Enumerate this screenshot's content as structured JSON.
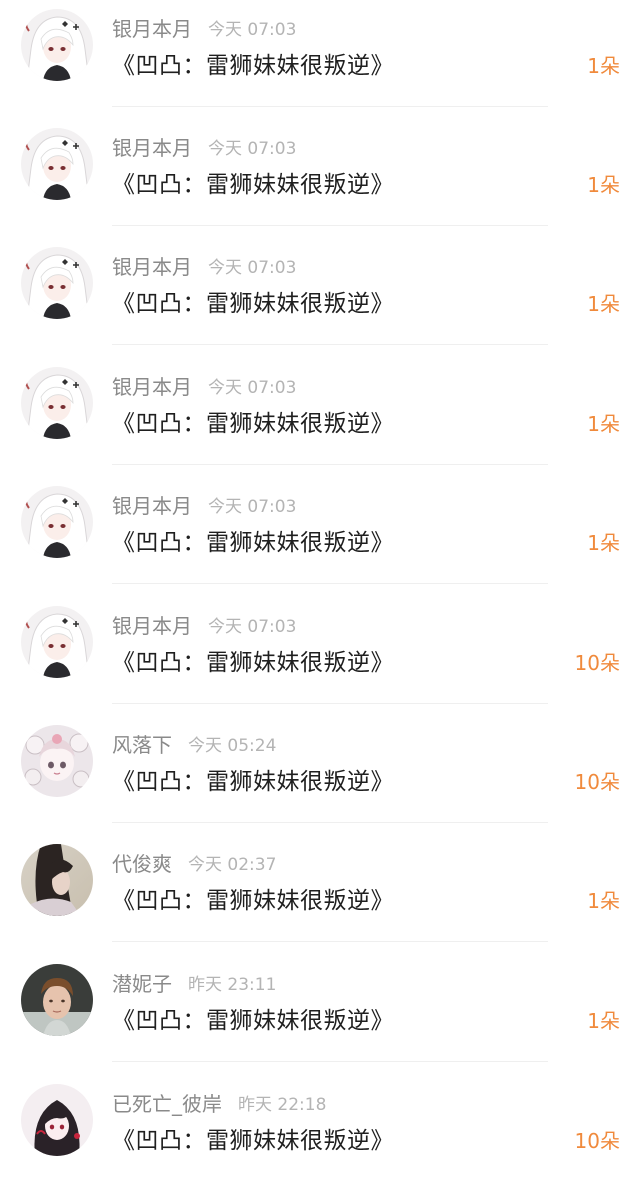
{
  "colors": {
    "username": "#8a8a8a",
    "timestamp": "#b4b4b4",
    "title": "#1f1f1f",
    "count": "#f08a3c",
    "divider": "#efefef"
  },
  "rows": [
    {
      "username": "银月本月",
      "time": "今天 07:03",
      "title": "《凹凸：雷狮妹妹很叛逆》",
      "count": "1朵",
      "avatar": "anime-white-hair-avatar"
    },
    {
      "username": "银月本月",
      "time": "今天 07:03",
      "title": "《凹凸：雷狮妹妹很叛逆》",
      "count": "1朵",
      "avatar": "anime-white-hair-avatar"
    },
    {
      "username": "银月本月",
      "time": "今天 07:03",
      "title": "《凹凸：雷狮妹妹很叛逆》",
      "count": "1朵",
      "avatar": "anime-white-hair-avatar"
    },
    {
      "username": "银月本月",
      "time": "今天 07:03",
      "title": "《凹凸：雷狮妹妹很叛逆》",
      "count": "1朵",
      "avatar": "anime-white-hair-avatar"
    },
    {
      "username": "银月本月",
      "time": "今天 07:03",
      "title": "《凹凸：雷狮妹妹很叛逆》",
      "count": "1朵",
      "avatar": "anime-white-hair-avatar"
    },
    {
      "username": "银月本月",
      "time": "今天 07:03",
      "title": "《凹凸：雷狮妹妹很叛逆》",
      "count": "10朵",
      "avatar": "anime-white-hair-avatar"
    },
    {
      "username": "风落下",
      "time": "今天 05:24",
      "title": "《凹凸：雷狮妹妹很叛逆》",
      "count": "10朵",
      "avatar": "anime-pastel-avatar"
    },
    {
      "username": "代俊爽",
      "time": "今天 02:37",
      "title": "《凹凸：雷狮妹妹很叛逆》",
      "count": "1朵",
      "avatar": "photo-girl-avatar"
    },
    {
      "username": "潜妮子",
      "time": "昨天 23:11",
      "title": "《凹凸：雷狮妹妹很叛逆》",
      "count": "1朵",
      "avatar": "photo-boy-avatar"
    },
    {
      "username": "已死亡_彼岸",
      "time": "昨天 22:18",
      "title": "《凹凸：雷狮妹妹很叛逆》",
      "count": "10朵",
      "avatar": "anime-dark-hair-avatar"
    }
  ]
}
